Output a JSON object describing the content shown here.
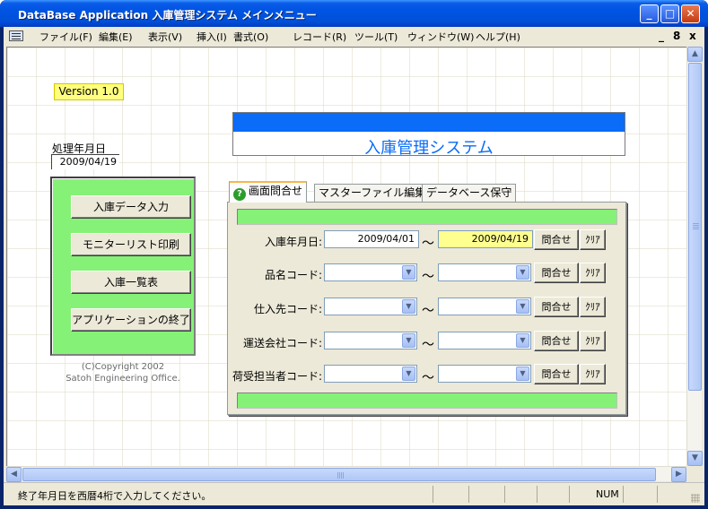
{
  "window": {
    "title": "DataBase Application 入庫管理システム メインメニュー"
  },
  "menubar": {
    "items": [
      "ファイル(F)",
      "編集(E)",
      "表示(V)",
      "挿入(I)",
      "書式(O)",
      "レコード(R)",
      "ツール(T)",
      "ウィンドウ(W)",
      "ヘルプ(H)"
    ],
    "mdi_controls": [
      "_",
      "8",
      "x"
    ]
  },
  "left": {
    "version": "Version 1.0",
    "date_label": "処理年月日",
    "date_value": "2009/04/19",
    "buttons": [
      "入庫データ入力",
      "モニターリスト印刷",
      "入庫一覧表",
      "アプリケーションの終了"
    ],
    "copyright_line1": "(C)Copyright 2002",
    "copyright_line2": "Satoh Engineering Office."
  },
  "banner": {
    "title": "入庫管理システム"
  },
  "tabs": [
    "画面問合せ",
    "マスターファイル編集",
    "データベース保守"
  ],
  "form": {
    "rows": [
      {
        "label": "入庫年月日:",
        "type": "text",
        "from": "2009/04/01",
        "to": "2009/04/19"
      },
      {
        "label": "品名コード:",
        "type": "combo",
        "from": "",
        "to": ""
      },
      {
        "label": "仕入先コード:",
        "type": "combo",
        "from": "",
        "to": ""
      },
      {
        "label": "運送会社コード:",
        "type": "combo",
        "from": "",
        "to": ""
      },
      {
        "label": "荷受担当者コード:",
        "type": "combo",
        "from": "",
        "to": ""
      }
    ],
    "separator": "〜",
    "query_label": "問合せ",
    "clear_label": "ｸﾘｱ"
  },
  "statusbar": {
    "message": "終了年月日を西暦4桁で入力してください。",
    "num": "NUM"
  },
  "colors": {
    "green_panel": "#85f277",
    "banner_blue": "#0a6cf7",
    "version_yellow": "#ffff7f",
    "highlight_field": "#ffff90"
  }
}
